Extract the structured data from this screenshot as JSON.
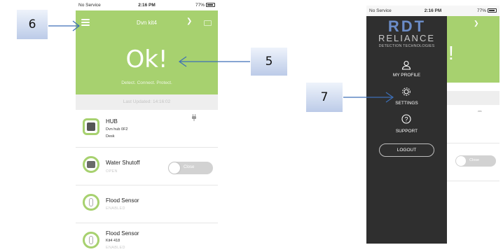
{
  "callouts": {
    "six": "6",
    "five": "5",
    "seven": "7"
  },
  "phone_a": {
    "status": {
      "carrier": "No Service",
      "time": "2:16 PM",
      "battery": "77%"
    },
    "header": {
      "title": "Dvn kit4"
    },
    "status_text": "Ok!",
    "tagline": "Detect. Connect. Protect.",
    "last_updated": "Last Updated: 14:16:02",
    "devices": [
      {
        "name": "HUB",
        "sub1": "Dvn hub 0F2",
        "sub2": "Desk"
      },
      {
        "name": "Water Shutoff",
        "status": "OPEN",
        "toggle_label": "Close"
      },
      {
        "name": "Flood Sensor",
        "status": "ENABLED"
      },
      {
        "name": "Flood Sensor",
        "sub1": "Kit4 418",
        "status": "ENABLED"
      }
    ]
  },
  "phone_b": {
    "status": {
      "carrier": "No Service",
      "time": "2:16 PM",
      "battery": "77%"
    },
    "logo": {
      "rdt": "RDT",
      "reliance": "RELIANCE",
      "detection": "DETECTION TECHNOLOGIES"
    },
    "menu": {
      "profile": "MY PROFILE",
      "settings": "SETTINGS",
      "support": "SUPPORT",
      "logout": "LOGOUT"
    },
    "bg_toggle_label": "Close"
  },
  "colors": {
    "accent_green": "#a7d16f",
    "drawer": "#2f2f2f",
    "arrow": "#3d6fb6"
  }
}
